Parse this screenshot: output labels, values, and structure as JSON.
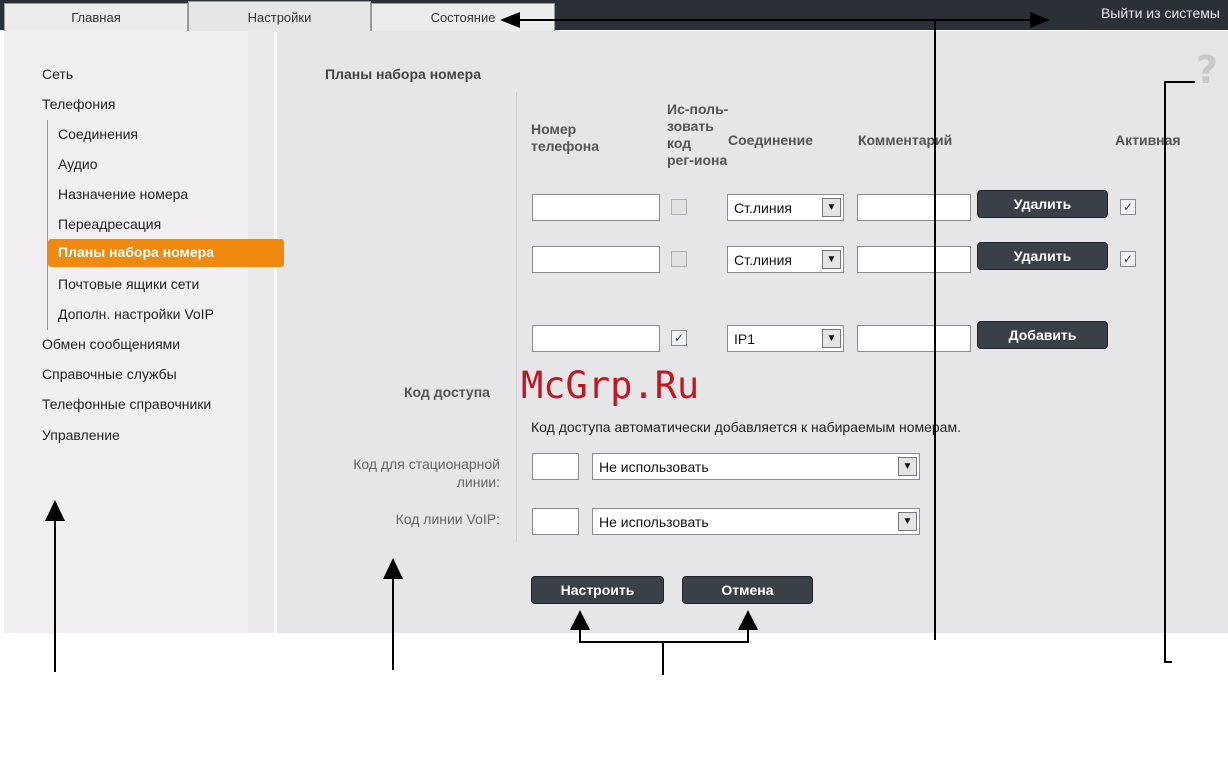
{
  "tabs": [
    {
      "label": "Главная",
      "active": false
    },
    {
      "label": "Настройки",
      "active": true
    },
    {
      "label": "Состояние",
      "active": false
    }
  ],
  "logout_label": "Выйти из системы",
  "sidebar": {
    "items": [
      {
        "label": "Сеть"
      },
      {
        "label": "Телефония"
      },
      {
        "label": "Соединения"
      },
      {
        "label": "Аудио"
      },
      {
        "label": "Назначение номера"
      },
      {
        "label": "Переадресация"
      },
      {
        "label": "Планы набора номера",
        "active": true
      },
      {
        "label": "Почтовые ящики сети"
      },
      {
        "label": "Дополн. настройки VoIP"
      },
      {
        "label": "Обмен сообщениями"
      },
      {
        "label": "Справочные службы"
      },
      {
        "label": "Телефонные справочники"
      },
      {
        "label": "Управление"
      }
    ]
  },
  "dialplans": {
    "title": "Планы набора номера",
    "columns": {
      "phone": [
        "Номер",
        "телефона"
      ],
      "area_code": [
        "Ис-поль-",
        "зовать",
        "код",
        "рег-иона"
      ],
      "connection": "Соединение",
      "comment": "Комментарий",
      "active": "Активная"
    },
    "rows": [
      {
        "phone": "",
        "use_area_code": false,
        "connection": "Ст.линия",
        "comment": "",
        "button": "Удалить",
        "active": true
      },
      {
        "phone": "",
        "use_area_code": false,
        "connection": "Ст.линия",
        "comment": "",
        "button": "Удалить",
        "active": true
      },
      {
        "phone": "",
        "use_area_code": true,
        "connection": "IP1",
        "comment": "",
        "button": "Добавить",
        "active": null
      }
    ]
  },
  "access_code": {
    "title": "Код доступа",
    "description": "Код доступа автоматически добавляется к набираемым номерам.",
    "fixed_line_label": [
      "Код для стационарной",
      "линии:"
    ],
    "fixed_line_value": "",
    "fixed_line_select": "Не использовать",
    "voip_label": "Код линии VoIP:",
    "voip_value": "",
    "voip_select": "Не использовать"
  },
  "buttons": {
    "apply": "Настроить",
    "cancel": "Отмена"
  },
  "watermark": "McGrp.Ru",
  "help_glyph": "?",
  "checkmark": "✓",
  "dropdown_glyph": "▼",
  "colors": {
    "accent": "#ef8a0e",
    "topbar": "#2b3036",
    "button": "#3a4048",
    "watermark": "#c01822"
  }
}
